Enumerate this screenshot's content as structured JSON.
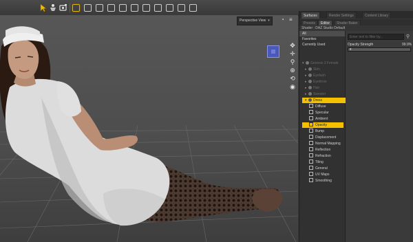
{
  "toolbar": {
    "tools": [
      "select-icon",
      "pose-icon",
      "camera-icon"
    ],
    "view_buttons": 11
  },
  "viewport": {
    "camera_label": "Perspective View",
    "nav_tools": [
      "rotate-icon",
      "pan-icon",
      "zoom-icon",
      "frame-icon",
      "reset-icon",
      "orbit-icon"
    ]
  },
  "panel": {
    "tabs": [
      "Surfaces",
      "Render Settings",
      "Content Library"
    ],
    "subtabs": [
      "Presets",
      "Editor",
      "Shader Baker"
    ],
    "shader_line": "Shader : DAZ Studio Default",
    "filters": [
      "All",
      "Favorites",
      "Currently Used"
    ],
    "tree": [
      {
        "label": "Genesis 3 Female",
        "level": 0,
        "style": "dim"
      },
      {
        "label": "Skin",
        "level": 1,
        "style": "dim"
      },
      {
        "label": "Eyelash",
        "level": 1,
        "style": "dim"
      },
      {
        "label": "Eyebrow",
        "level": 1,
        "style": "dim"
      },
      {
        "label": "Hair",
        "level": 1,
        "style": "dim"
      },
      {
        "label": "Sweater",
        "level": 1,
        "style": "dim"
      },
      {
        "label": "Dress",
        "level": 1,
        "style": "highlight"
      },
      {
        "label": "Diffuse",
        "level": 2,
        "style": "bright"
      },
      {
        "label": "Specular",
        "level": 2,
        "style": "bright"
      },
      {
        "label": "Ambient",
        "level": 2,
        "style": "bright"
      },
      {
        "label": "Opacity",
        "level": 2,
        "style": "highlight"
      },
      {
        "label": "Bump",
        "level": 2,
        "style": "bright"
      },
      {
        "label": "Displacement",
        "level": 2,
        "style": "bright"
      },
      {
        "label": "Normal Mapping",
        "level": 2,
        "style": "bright"
      },
      {
        "label": "Reflection",
        "level": 2,
        "style": "bright"
      },
      {
        "label": "Refraction",
        "level": 2,
        "style": "bright"
      },
      {
        "label": "Tiling",
        "level": 2,
        "style": "bright"
      },
      {
        "label": "General",
        "level": 2,
        "style": "bright"
      },
      {
        "label": "UV Maps",
        "level": 2,
        "style": "bright"
      },
      {
        "label": "Smoothing",
        "level": 2,
        "style": "bright"
      }
    ],
    "search_placeholder": "Enter text to filter by...",
    "property": {
      "label": "Opacity Strength",
      "value": "99.9%",
      "fraction": 0.999
    }
  },
  "colors": {
    "highlight": "#f5c000",
    "viewport": "#4e4e4e",
    "panel": "#353535"
  }
}
